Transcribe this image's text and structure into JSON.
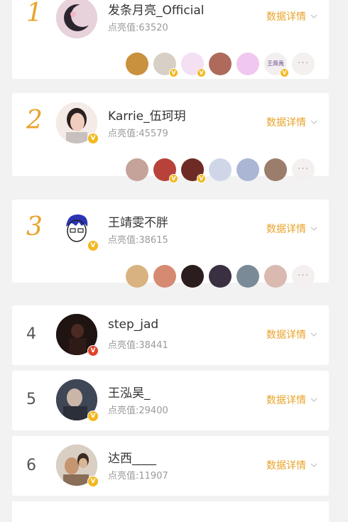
{
  "detail_label": "数据详情",
  "rows": [
    {
      "rank": "1",
      "name": "发条月亮_Official",
      "score": "点亮值:63520",
      "badge": "V",
      "colors": {
        "avatar": "#d9c1cf"
      },
      "fans": [
        {
          "color": "#c9903e",
          "v": false
        },
        {
          "color": "#d8cfc6",
          "v": true
        },
        {
          "color": "#f4e0f2",
          "v": true
        },
        {
          "color": "#b06a5c",
          "v": false
        },
        {
          "color": "#f0c8ef",
          "v": false
        },
        {
          "color": "#f3eef0",
          "v": true,
          "text": "王舜禹"
        }
      ]
    },
    {
      "rank": "2",
      "name": "Karrie_伍珂玥",
      "score": "点亮值:45579",
      "badge": "V",
      "colors": {
        "avatar": "#e6c7bd"
      },
      "fans": [
        {
          "color": "#c5a39a",
          "v": false
        },
        {
          "color": "#b8413a",
          "v": true
        },
        {
          "color": "#6e2a24",
          "v": true
        },
        {
          "color": "#cfd6e8",
          "v": false
        },
        {
          "color": "#aab6d4",
          "v": false
        },
        {
          "color": "#9b7d6b",
          "v": false
        }
      ]
    },
    {
      "rank": "3",
      "name": "王靖雯不胖",
      "score": "点亮值:38615",
      "badge": "V",
      "colors": {
        "avatar": "#ffffff"
      },
      "fans": [
        {
          "color": "#d8b37f",
          "v": false
        },
        {
          "color": "#d78a72",
          "v": false
        },
        {
          "color": "#2b1d1d",
          "v": false
        },
        {
          "color": "#3a3042",
          "v": false
        },
        {
          "color": "#7a8b97",
          "v": false
        },
        {
          "color": "#d9b9b0",
          "v": false
        }
      ]
    },
    {
      "rank": "4",
      "name": "step_jad",
      "score": "点亮值:38441",
      "badge": "V",
      "colors": {
        "avatar": "#2a1a18"
      }
    },
    {
      "rank": "5",
      "name": "王泓昊_",
      "score": "点亮值:29400",
      "badge": "V",
      "colors": {
        "avatar": "#3a4150"
      }
    },
    {
      "rank": "6",
      "name": "达西____",
      "score": "点亮值:11907",
      "badge": "V",
      "colors": {
        "avatar": "#b69478"
      }
    }
  ],
  "more_label": "···",
  "accent": "#e8a32a"
}
